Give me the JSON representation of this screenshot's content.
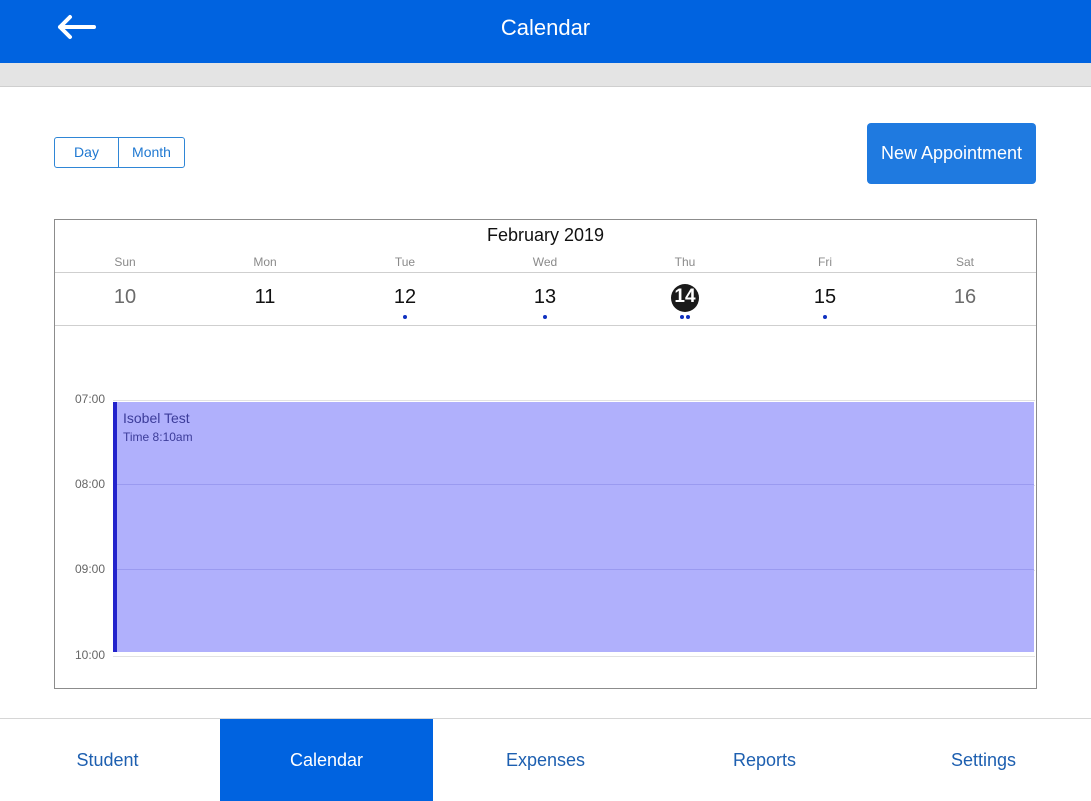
{
  "header": {
    "title": "Calendar",
    "back_icon": "arrow-left-icon"
  },
  "view_toggle": {
    "day_label": "Day",
    "month_label": "Month"
  },
  "new_appointment_label": "New Appointment",
  "calendar": {
    "month_title": "February 2019",
    "weekdays": [
      "Sun",
      "Mon",
      "Tue",
      "Wed",
      "Thu",
      "Fri",
      "Sat"
    ],
    "dates": [
      "10",
      "11",
      "12",
      "13",
      "14",
      "15",
      "16"
    ],
    "selected_date": "14",
    "event_dot_counts": [
      0,
      0,
      1,
      1,
      2,
      1,
      0
    ],
    "hours": [
      "07:00",
      "08:00",
      "09:00",
      "10:00"
    ]
  },
  "event": {
    "title": "Isobel Test",
    "time": "Time 8:10am"
  },
  "nav": {
    "items": [
      "Student",
      "Calendar",
      "Expenses",
      "Reports",
      "Settings"
    ],
    "active": "Calendar"
  },
  "colors": {
    "primary": "#0063e0",
    "button": "#1f7ae0",
    "event_fill": "#b0b0fc",
    "event_border": "#2222cc",
    "dot": "#1030c0"
  }
}
